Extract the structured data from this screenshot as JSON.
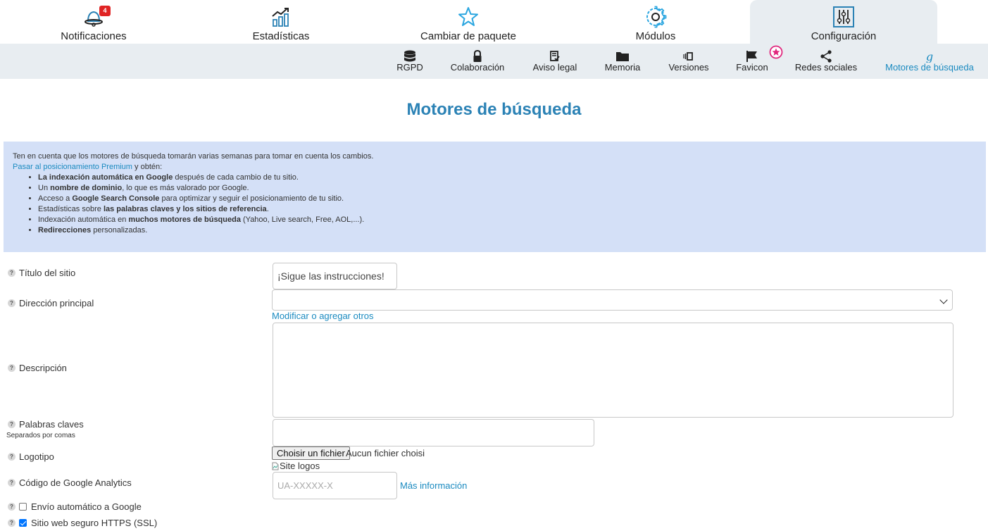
{
  "topnav": {
    "tabs": [
      {
        "label": "Notificaciones",
        "icon": "bell-icon",
        "badge": "4"
      },
      {
        "label": "Estadísticas",
        "icon": "chart-icon"
      },
      {
        "label": "Cambiar de paquete",
        "icon": "star-icon"
      },
      {
        "label": "Módulos",
        "icon": "gear-icon"
      },
      {
        "label": "Configuración",
        "icon": "sliders-icon",
        "active": true
      }
    ]
  },
  "subnav": {
    "items": [
      {
        "label": "RGPD",
        "icon": "database-icon"
      },
      {
        "label": "Colaboración",
        "icon": "lock-icon"
      },
      {
        "label": "Aviso legal",
        "icon": "legal-doc-icon"
      },
      {
        "label": "Memoria",
        "icon": "folder-icon"
      },
      {
        "label": "Versiones",
        "icon": "versions-icon"
      },
      {
        "label": "Favicon",
        "icon": "flag-icon"
      },
      {
        "label": "Redes sociales",
        "icon": "share-icon"
      },
      {
        "label": "Motores de búsqueda",
        "icon": "google-icon",
        "active": true
      }
    ]
  },
  "page_title": "Motores de búsqueda",
  "info": {
    "line1": "Ten en cuenta que los motores de búsqueda tomarán varias semanas para tomar en cuenta los cambios.",
    "premium_link": "Pasar al posicionamiento Premium",
    "premium_after": " y obtén:",
    "bullets": [
      {
        "pre": "",
        "bold": "La indexación automática en Google",
        "post": " después de cada cambio de tu sitio."
      },
      {
        "pre": "Un ",
        "bold": "nombre de dominio",
        "post": ", lo que es más valorado por Google."
      },
      {
        "pre": "Acceso a ",
        "bold": "Google Search Console",
        "post": " para optimizar y seguir el posicionamiento de tu sitio."
      },
      {
        "pre": "Estadísticas sobre ",
        "bold": "las palabras claves y los sitios de referencia",
        "post": "."
      },
      {
        "pre": "Indexación automática en ",
        "bold": "muchos motores de búsqueda",
        "post": " (Yahoo, Live search, Free, AOL,...)."
      },
      {
        "pre": "",
        "bold": "Redirecciones",
        "post": " personalizadas."
      }
    ]
  },
  "form": {
    "title_label": "Título del sitio",
    "title_value": "¡Sigue las instrucciones!",
    "address_label": "Dirección principal",
    "address_value": "",
    "address_link": "Modificar o agregar otros",
    "description_label": "Descripción",
    "description_value": "",
    "keywords_label": "Palabras claves",
    "keywords_hint": "Separados por comas",
    "keywords_value": "",
    "logo_label": "Logotipo",
    "file_button": "Choisir un fichier",
    "file_status": "Aucun fichier choisi",
    "logo_alt": "Site logos",
    "analytics_label": "Código de Google Analytics",
    "analytics_placeholder": "UA-XXXXX-X",
    "analytics_link": "Más información",
    "auto_submit_label": "Envío automático a Google",
    "auto_submit_checked": false,
    "ssl_label": "Sitio web seguro HTTPS (SSL)",
    "ssl_checked": true
  },
  "colors": {
    "accent": "#1a8ac0",
    "title": "#2b82b5",
    "info_bg": "#d4e0f7",
    "nav_bg": "#e8edf1",
    "badge": "#e02424"
  }
}
